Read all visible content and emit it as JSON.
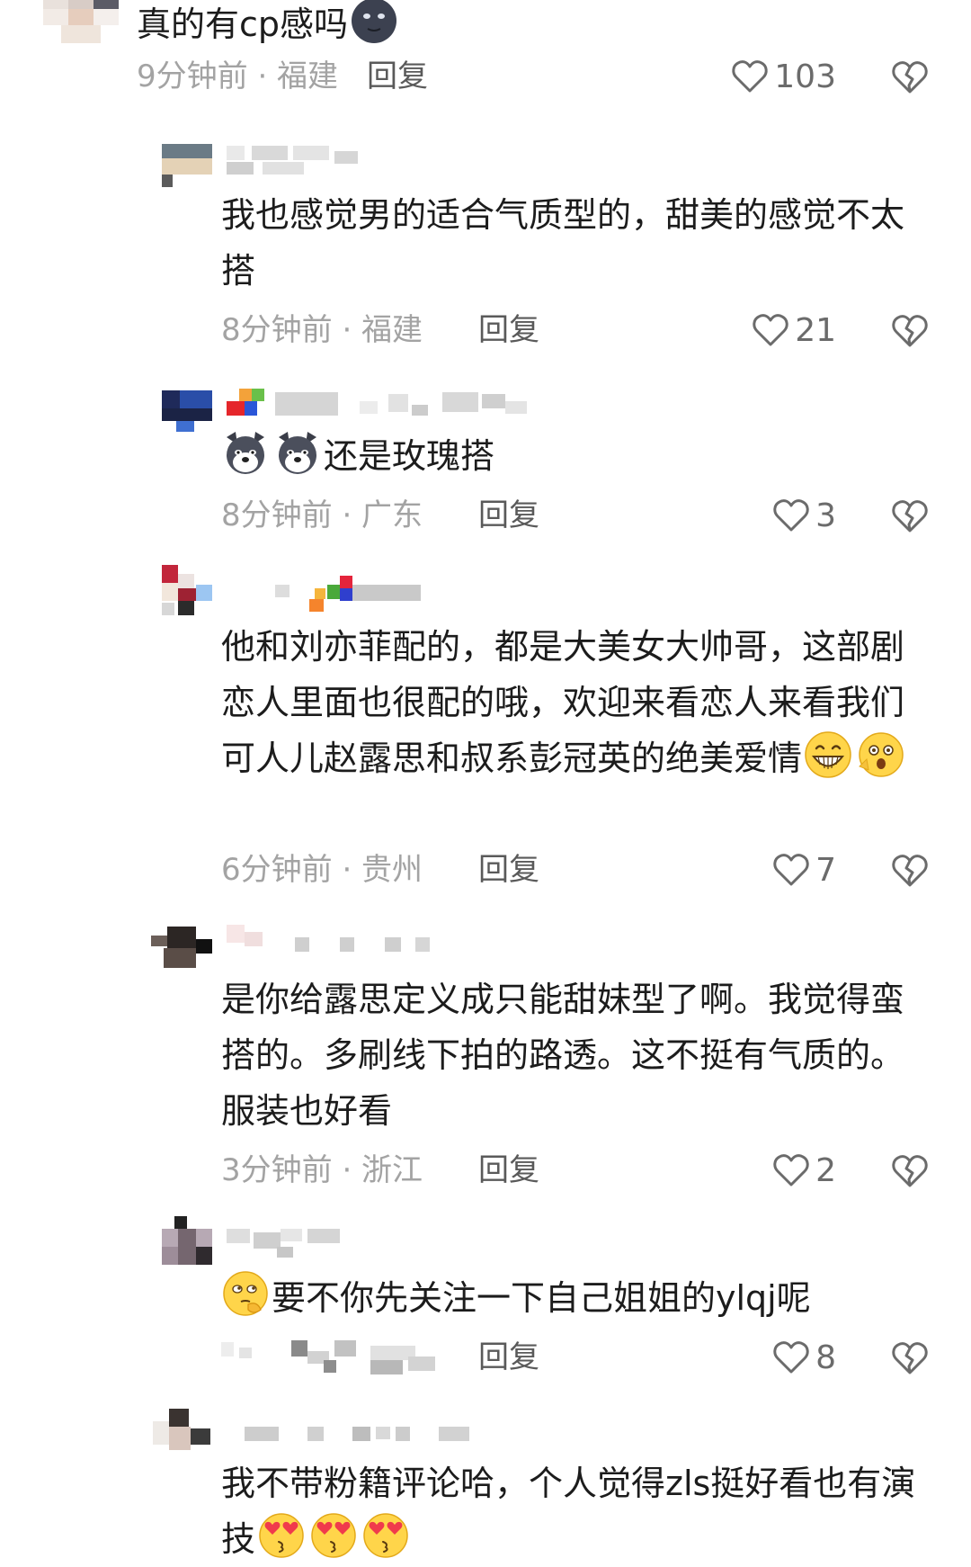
{
  "colors": {
    "text": "#1c1c1c",
    "meta": "#a3a3a3",
    "reply": "#5a5a5a",
    "icon": "#6b6b6b"
  },
  "comments": [
    {
      "text": "真的有cp感吗",
      "meta": "9分钟前 · 福建",
      "reply": "回复",
      "likes": "103",
      "emojis": [
        "dark-face-emoji"
      ]
    },
    {
      "text": "我也感觉男的适合气质型的，甜美的感觉不太搭",
      "meta": "8分钟前 · 福建",
      "reply": "回复",
      "likes": "21"
    },
    {
      "text": "还是玫瑰搭",
      "meta": "8分钟前 · 广东",
      "reply": "回复",
      "likes": "3",
      "emojis": [
        "husky-emoji",
        "husky-emoji"
      ]
    },
    {
      "text": "他和刘亦菲配的，都是大美女大帅哥，这部剧恋人里面也很配的哦，欢迎来看恋人来看我们可人儿赵露思和叔系彭冠英的绝美爱情",
      "meta": "6分钟前 · 贵州",
      "reply": "回复",
      "likes": "7",
      "emojis": [
        "grinning-emoji",
        "shocked-emoji"
      ]
    },
    {
      "text": "是你给露思定义成只能甜妹型了啊。我觉得蛮搭的。多刷线下拍的路透。这不挺有气质的。服装也好看",
      "meta": "3分钟前 · 浙江",
      "reply": "回复",
      "likes": "2"
    },
    {
      "text": "要不你先关注一下自己姐姐的ylqj呢",
      "reply": "回复",
      "likes": "8",
      "emojis": [
        "thinking-emoji"
      ]
    },
    {
      "text": "我不带粉籍评论哈，个人觉得zls挺好看也有演技",
      "emojis": [
        "heart-eyes-emoji",
        "heart-eyes-emoji",
        "heart-eyes-emoji"
      ]
    }
  ]
}
